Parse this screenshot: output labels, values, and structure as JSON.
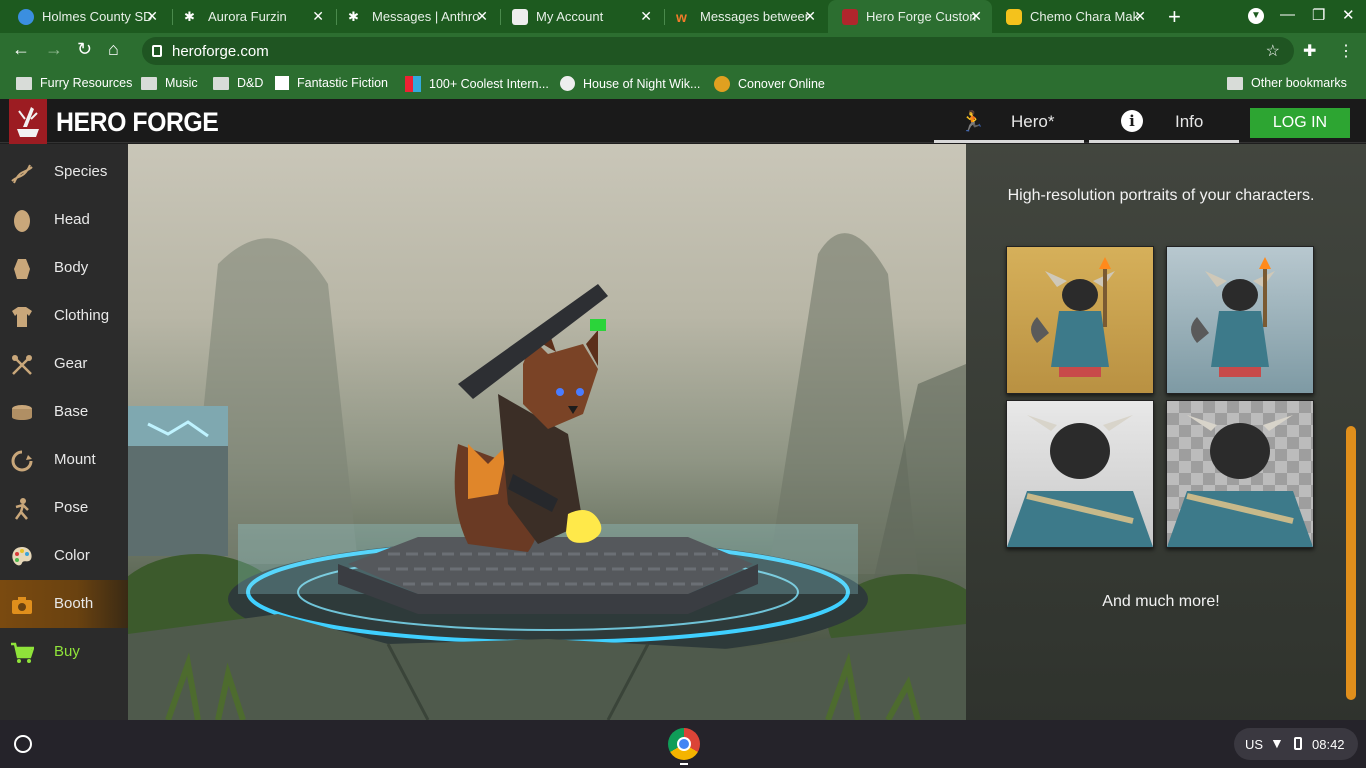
{
  "browser": {
    "tabs": [
      {
        "title": "Holmes County SD",
        "favicon_color": "#3b8fe0"
      },
      {
        "title": "Aurora Furzin",
        "favicon_color": "#ffffff"
      },
      {
        "title": "Messages | Anthro",
        "favicon_color": "#ffffff"
      },
      {
        "title": "My Account",
        "favicon_color": "#eeeeee"
      },
      {
        "title": "Messages between",
        "favicon_color": "#f07a2a"
      },
      {
        "title": "Hero Forge Custom",
        "favicon_color": "#b0262c"
      },
      {
        "title": "Chemo Chara Mak",
        "favicon_color": "#f4c21c"
      }
    ],
    "active_tab_index": 5,
    "url": "heroforge.com",
    "bookmarks": [
      {
        "label": "Furry Resources",
        "icon": "folder-icon"
      },
      {
        "label": "Music",
        "icon": "folder-icon"
      },
      {
        "label": "D&D",
        "icon": "folder-icon"
      },
      {
        "label": "Fantastic Fiction",
        "icon": "ff-icon"
      },
      {
        "label": "100+ Coolest Intern...",
        "icon": "coolest-icon"
      },
      {
        "label": "House of Night Wik...",
        "icon": "globe-icon"
      },
      {
        "label": "Conover Online",
        "icon": "conover-icon"
      }
    ],
    "other_bookmarks": "Other bookmarks"
  },
  "app": {
    "logo": "HERO FORGE",
    "header_tabs": [
      {
        "label": "Hero*",
        "icon": "hero-icon"
      },
      {
        "label": "Info",
        "icon": "info-icon"
      }
    ],
    "login_label": "LOG IN",
    "sidebar": [
      {
        "label": "Species",
        "icon": "dna-icon"
      },
      {
        "label": "Head",
        "icon": "head-icon"
      },
      {
        "label": "Body",
        "icon": "body-icon"
      },
      {
        "label": "Clothing",
        "icon": "shirt-icon"
      },
      {
        "label": "Gear",
        "icon": "axes-icon"
      },
      {
        "label": "Base",
        "icon": "base-icon"
      },
      {
        "label": "Mount",
        "icon": "mount-icon"
      },
      {
        "label": "Pose",
        "icon": "pose-icon"
      },
      {
        "label": "Color",
        "icon": "palette-icon"
      },
      {
        "label": "Booth",
        "icon": "camera-icon"
      },
      {
        "label": "Buy",
        "icon": "cart-icon"
      }
    ],
    "active_sidebar": "Booth",
    "panel": {
      "title": "High-resolution portraits of your characters.",
      "more": "And much more!"
    },
    "colors": {
      "accent": "#e08f1c",
      "login": "#2da532",
      "buy": "#8fe33a",
      "brand": "#9c1c22"
    }
  },
  "system": {
    "locale": "US",
    "time": "08:42"
  }
}
